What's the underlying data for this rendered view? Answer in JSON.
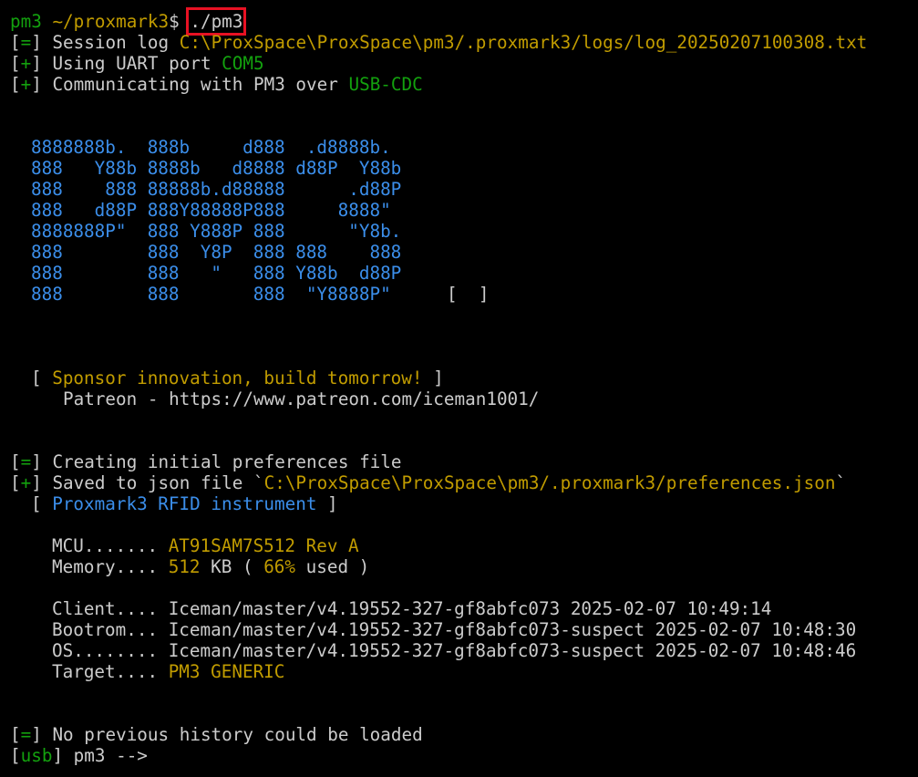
{
  "colors": {
    "background": "#000000",
    "default": "#cccccc",
    "green": "#13a10e",
    "yellow": "#c19c00",
    "blue": "#3b8eea",
    "highlight_box": "#e81123"
  },
  "prompt": {
    "user": "pm3",
    "path": "~/proxmark3",
    "dollar": "$",
    "command": "./pm3"
  },
  "session": {
    "log_prefix": "[",
    "log_mark": "=",
    "log_suffix": "] Session log ",
    "log_path": "C:\\ProxSpace\\ProxSpace\\pm3/.proxmark3/logs/log_20250207100308.txt",
    "uart_text": "Using UART port ",
    "uart_port": "COM5",
    "comm_text": "Communicating with PM3 over ",
    "comm_mode": "USB-CDC"
  },
  "logo": {
    "lines": [
      "8888888b.  888b     d888  .d8888b.",
      "888   Y88b 8888b   d8888 d88P  Y88b",
      "888    888 88888b.d88888      .d88P",
      "888   d88P 888Y88888P888     8888\"",
      "8888888P\"  888 Y888P 888      \"Y8b.",
      "888        888  Y8P  888 888    888",
      "888        888   \"   888 Y88b  d88P",
      "888        888       888  \"Y8888P\""
    ],
    "bracket": "[  ]"
  },
  "sponsor": {
    "line": "Sponsor innovation, build tomorrow!",
    "patreon": "Patreon - https://www.patreon.com/iceman1001/"
  },
  "prefs": {
    "creating": "Creating initial preferences file",
    "saved_text": "Saved to json file `",
    "saved_path": "C:\\ProxSpace\\ProxSpace\\pm3/.proxmark3/preferences.json",
    "saved_tick": "`"
  },
  "instrument": {
    "title": "Proxmark3 RFID instrument"
  },
  "info": {
    "mcu_label": "MCU.......",
    "mcu_value": "AT91SAM7S512 Rev A",
    "mem_label": "Memory....",
    "mem_size": "512",
    "mem_unit": "KB ( ",
    "mem_pct": "66%",
    "mem_tail": " used )",
    "client_label": "Client....",
    "client_value": "Iceman/master/v4.19552-327-gf8abfc073 2025-02-07 10:49:14",
    "boot_label": "Bootrom...",
    "boot_value": "Iceman/master/v4.19552-327-gf8abfc073-suspect 2025-02-07 10:48:30",
    "os_label": "OS........",
    "os_value": "Iceman/master/v4.19552-327-gf8abfc073-suspect 2025-02-07 10:48:46",
    "target_label": "Target....",
    "target_value": "PM3 GENERIC"
  },
  "history": {
    "text": "No previous history could be loaded"
  },
  "shell": {
    "mode": "usb",
    "prompt": "pm3 -->"
  }
}
